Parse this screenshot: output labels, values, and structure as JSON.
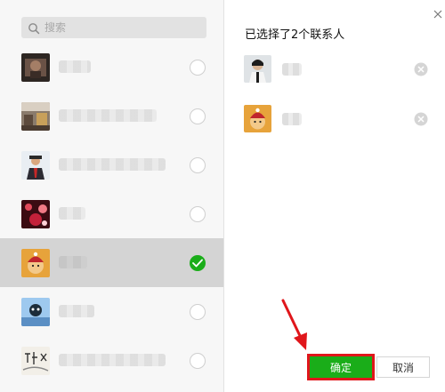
{
  "search": {
    "placeholder": "搜索",
    "icon": "search-icon"
  },
  "contacts": [
    {
      "selected": false,
      "avatar": "avatar-dark-photo"
    },
    {
      "selected": false,
      "avatar": "avatar-room-photo"
    },
    {
      "selected": false,
      "avatar": "avatar-man-red-tie"
    },
    {
      "selected": false,
      "avatar": "avatar-red-lights"
    },
    {
      "selected": true,
      "avatar": "avatar-red-hat"
    },
    {
      "selected": false,
      "avatar": "avatar-blue-character"
    },
    {
      "selected": false,
      "avatar": "avatar-calligraphy"
    }
  ],
  "right_panel": {
    "title": "已选择了2个联系人",
    "selected_contacts": [
      {
        "avatar": "avatar-person-photo"
      },
      {
        "avatar": "avatar-red-hat"
      }
    ]
  },
  "buttons": {
    "confirm": "确定",
    "cancel": "取消"
  },
  "colors": {
    "accent": "#1aad19",
    "highlight": "#e0161b"
  }
}
